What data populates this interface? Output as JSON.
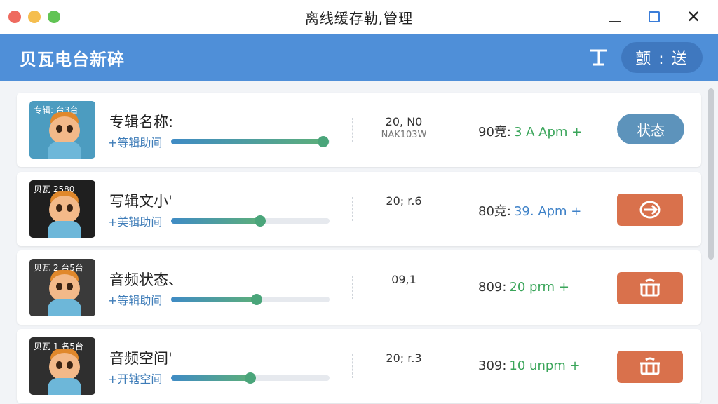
{
  "window": {
    "title": "离线缓存勒,管理"
  },
  "header": {
    "app_title": "贝瓦电台新碎",
    "pill_label": "颤 : 送"
  },
  "rows": [
    {
      "thumb_text": "专辑: 台3台",
      "thumb_bg": "#4c9cc0",
      "name": "专辑名称:",
      "sub": "+等辑助间",
      "progress": 0.96,
      "meta1": "20, N0",
      "meta2": "NAK103W",
      "rate_label": "90竞:",
      "rate_value": "3 A Apm +",
      "rate_color": "#3aa55a",
      "action": {
        "type": "status",
        "label": "状态"
      }
    },
    {
      "thumb_text": "贝瓦 2580",
      "thumb_bg": "#1f1f1f",
      "name": "写辑文小'",
      "sub": "+美辑助间",
      "progress": 0.56,
      "meta1": "20; r.6",
      "meta2": "",
      "rate_label": "80竞:",
      "rate_value": "39. Apm +",
      "rate_color": "#3f82c8",
      "action": {
        "type": "orange",
        "icon": "send-icon"
      }
    },
    {
      "thumb_text": "贝瓦 2 台5台",
      "thumb_bg": "#3a3a3a",
      "name": "音频状态、",
      "sub": "+等辑助间",
      "progress": 0.54,
      "meta1": "09,1",
      "meta2": "",
      "rate_label": "809:",
      "rate_value": "20 prm +",
      "rate_color": "#3aa55a",
      "action": {
        "type": "orange",
        "icon": "box-icon"
      }
    },
    {
      "thumb_text": "贝瓦 1 名5台",
      "thumb_bg": "#2f2f2f",
      "name": "音频空间'",
      "sub": "+开辖空间",
      "progress": 0.5,
      "meta1": "20; r.3",
      "meta2": "",
      "rate_label": "309:",
      "rate_value": "10 unpm +",
      "rate_color": "#3aa55a",
      "action": {
        "type": "orange",
        "icon": "box-icon"
      }
    }
  ]
}
